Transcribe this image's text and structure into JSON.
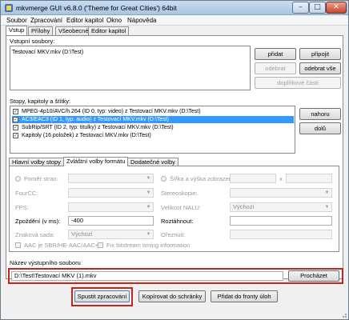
{
  "window": {
    "title": "mkvmerge GUI v6.8.0 ('Theme for Great Cities') 64bit"
  },
  "menu": [
    "Soubor",
    "Zpracování",
    "Editor kapitol",
    "Okno",
    "Nápověda"
  ],
  "main_tabs": [
    "Vstup",
    "Přílohy",
    "Všeobecné",
    "Editor kapitol"
  ],
  "input_files": {
    "label": "Vstupní soubory:",
    "items": [
      "Testovací MKV.mkv (D:\\Test)"
    ],
    "buttons": {
      "add": "přidat",
      "append": "připojit",
      "remove": "odebrat",
      "remove_all": "odebrat vše",
      "additional_parts": "doplňkové části"
    }
  },
  "tracks": {
    "label": "Stopy, kapitoly a štítky:",
    "items": [
      {
        "checked": true,
        "label": "MPEG-4p10/AVC/h.264 (ID 0, typ: video) z Testovací MKV.mkv (D:\\Test)"
      },
      {
        "checked": true,
        "label": "AC3/EAC3 (ID 1, typ: audio) z Testovací MKV.mkv (D:\\Test)"
      },
      {
        "checked": true,
        "label": "SubRip/SRT (ID 2, typ: titulky) z Testovací MKV.mkv (D:\\Test)"
      },
      {
        "checked": true,
        "label": "Kapitoly (16 položek) z Testovací MKV.mkv (D:\\Test)"
      }
    ],
    "selected_index": 1,
    "buttons": {
      "up": "nahoru",
      "down": "dolů"
    }
  },
  "option_tabs": [
    "Hlavní volby stopy",
    "Zvláštní volby formátu",
    "Dodatečné volby"
  ],
  "format_options": {
    "aspect_ratio": "Poměr stran:",
    "fourcc": "FourCC:",
    "fps": "FPS:",
    "delay_label": "Zpoždění (v ms):",
    "delay_value": "-400",
    "charset": "Znaková sada:",
    "charset_value": "Výchozí",
    "aac_sbr": "AAC je SBR/HE-AAC/AAC+",
    "size_label": "Šířka a výška zobrazení:",
    "stereoscopy": "Stereoskopie:",
    "nalu_size": "Velikost NALU:",
    "nalu_value": "Výchozí",
    "stretch_label": "Roztáhnout:",
    "cues": "Ořeznutí:",
    "fix_bitstream": "Fix bitstream timing information"
  },
  "output": {
    "label": "Název výstupního souboru",
    "path": "D:\\Test\\Testovací MKV (1).mkv",
    "browse": "Procházet"
  },
  "bottom_buttons": {
    "start": "Spustit zpracování",
    "copy_clipboard": "Kopírovat do schránky",
    "add_queue": "Přidat do fronty úloh"
  },
  "colors": {
    "accent_highlight": "#3399ff",
    "annotation_red": "#c8241e"
  }
}
